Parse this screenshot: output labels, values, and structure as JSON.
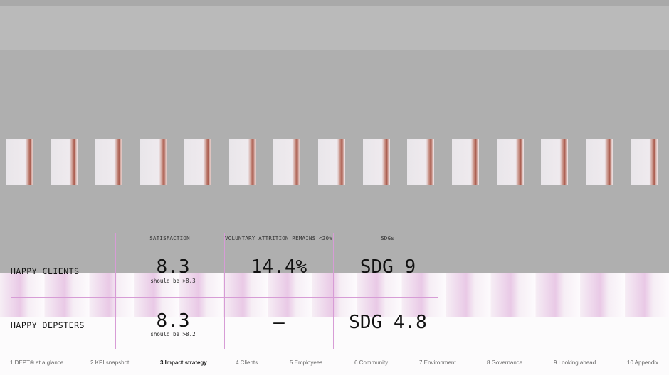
{
  "table": {
    "headers": [
      "SATISFACTION",
      "VOLUNTARY ATTRITION REMAINS <20%",
      "SDGs"
    ],
    "rows": [
      {
        "label": "HAPPY CLIENTS",
        "satisfaction": "8.3",
        "satisfaction_note": "should be >8.3",
        "attrition": "14.4%",
        "sdg": "SDG 9"
      },
      {
        "label": "HAPPY DEPSTERS",
        "satisfaction": "8.3",
        "satisfaction_note": "should be >8.2",
        "attrition": "—",
        "sdg": "SDG 4.8"
      }
    ]
  },
  "nav": [
    {
      "label": "1  DEPT® at a glance"
    },
    {
      "label": "2  KPI snapshot"
    },
    {
      "label": "3  Impact strategy",
      "active": true
    },
    {
      "label": "4  Clients"
    },
    {
      "label": "5  Employees"
    },
    {
      "label": "6  Community"
    },
    {
      "label": "7  Environment"
    },
    {
      "label": "8  Governance"
    },
    {
      "label": "9  Looking ahead"
    },
    {
      "label": "10  Appendix"
    }
  ],
  "colors": {
    "grid_line": "#d79cd6",
    "accent_pink": "#e9c9e6",
    "tile_stripe": "#a7594c"
  }
}
